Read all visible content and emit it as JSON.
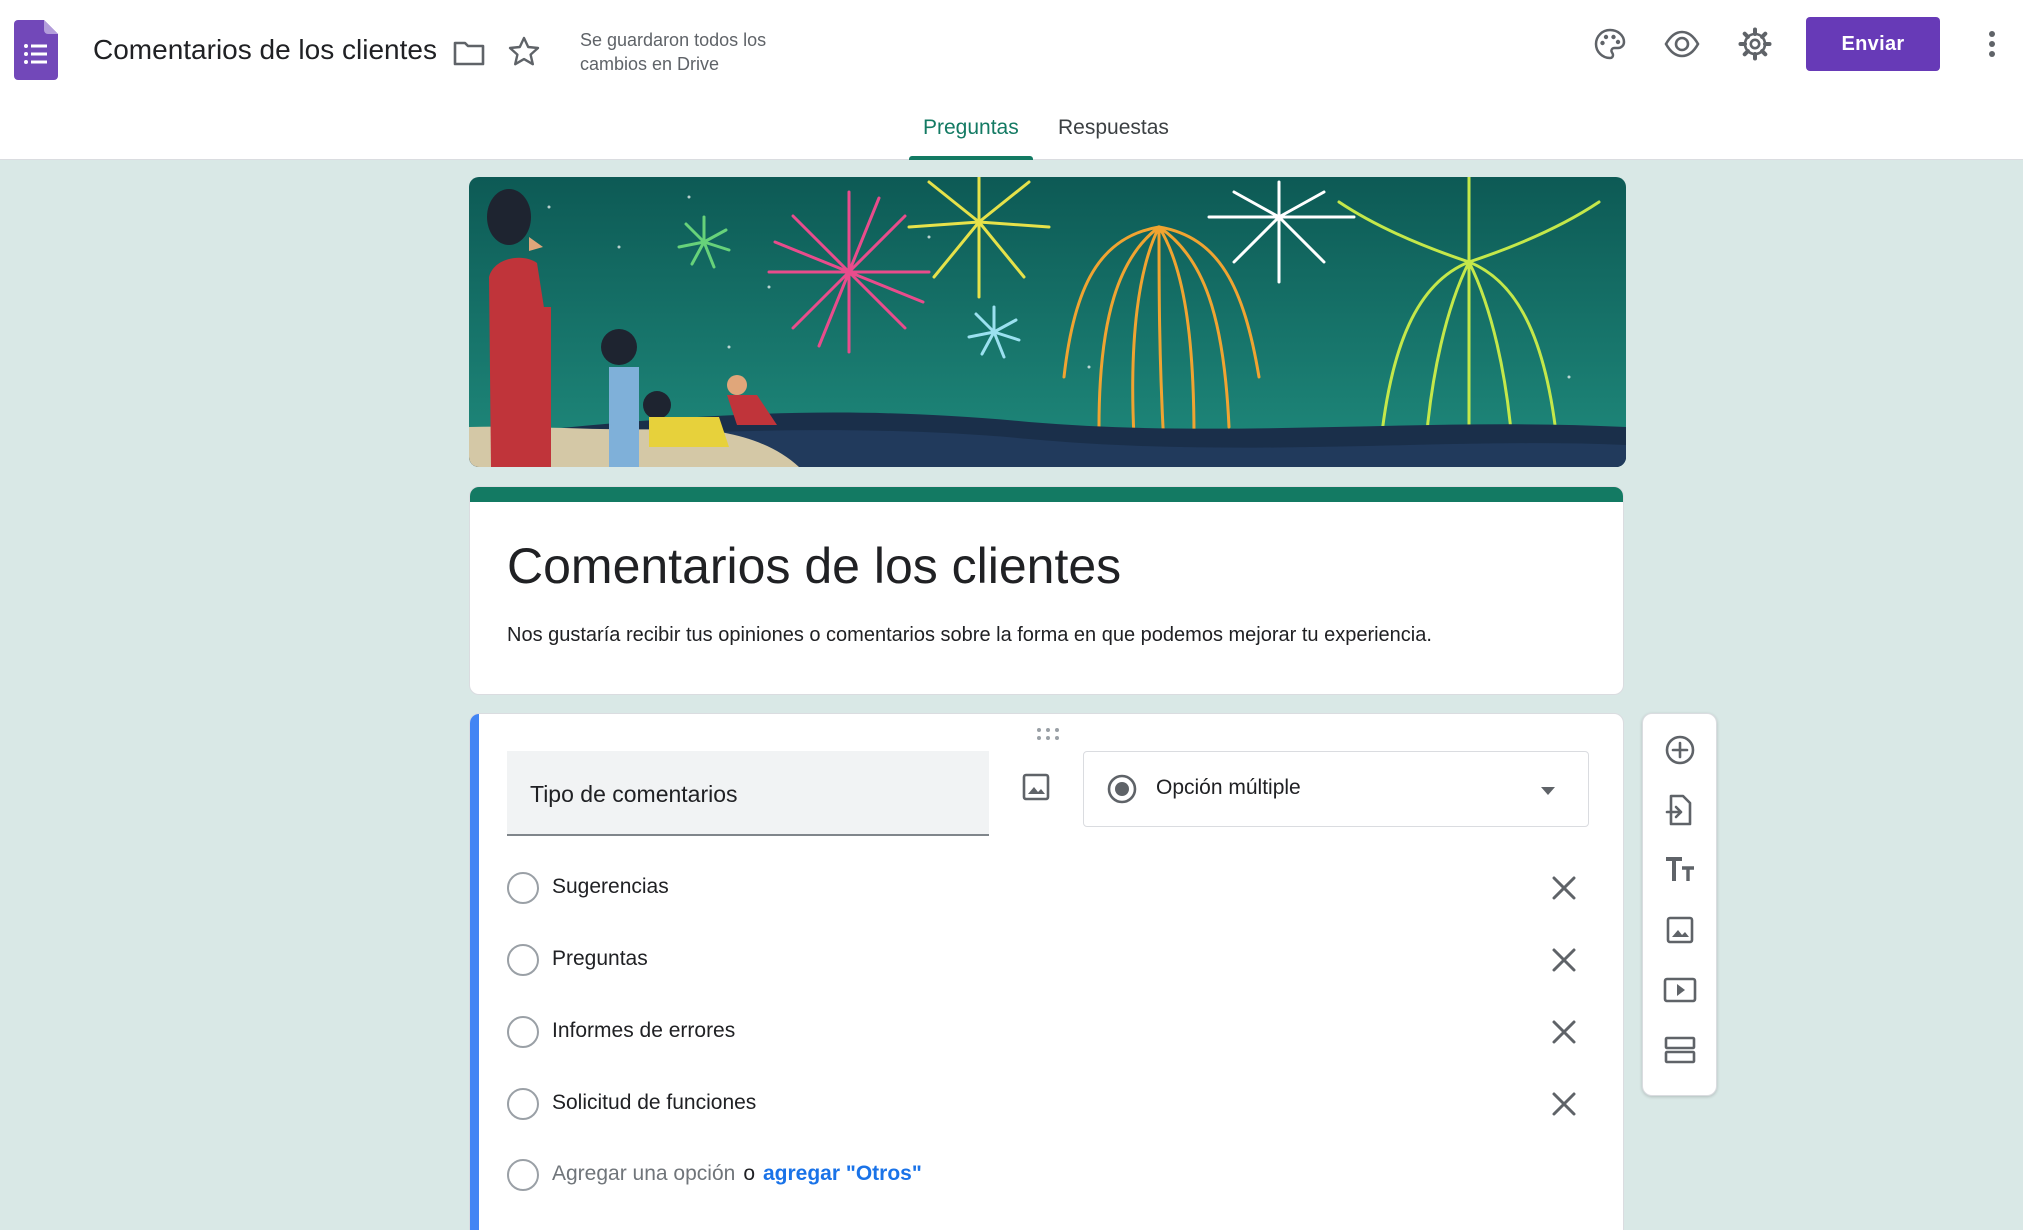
{
  "header": {
    "doc_title": "Comentarios de los clientes",
    "save_status": "Se guardaron todos los cambios en Drive",
    "send_label": "Enviar"
  },
  "tabs": [
    {
      "label": "Preguntas",
      "active": true
    },
    {
      "label": "Respuestas",
      "active": false
    }
  ],
  "form": {
    "title": "Comentarios de los clientes",
    "description": "Nos gustaría recibir tus opiniones o comentarios sobre la forma en que podemos mejorar tu experiencia."
  },
  "question": {
    "title": "Tipo de comentarios",
    "type": "Opción múltiple",
    "options": [
      "Sugerencias",
      "Preguntas",
      "Informes de errores",
      "Solicitud de funciones"
    ],
    "add_option": "Agregar una opción",
    "add_or": "o",
    "add_other": "agregar \"Otros\""
  },
  "colors": {
    "accent": "#137a63",
    "send_button": "#673ab7",
    "background": "#d9e8e6",
    "active_bar": "#4285f4"
  },
  "icons": {
    "header": [
      "forms-app-icon",
      "folder-icon",
      "star-icon",
      "palette-icon",
      "preview-eye-icon",
      "settings-gear-icon",
      "more-vert-icon"
    ],
    "toolbar": [
      "add-question-icon",
      "import-questions-icon",
      "add-title-icon",
      "add-image-icon",
      "add-video-icon",
      "add-section-icon"
    ]
  }
}
